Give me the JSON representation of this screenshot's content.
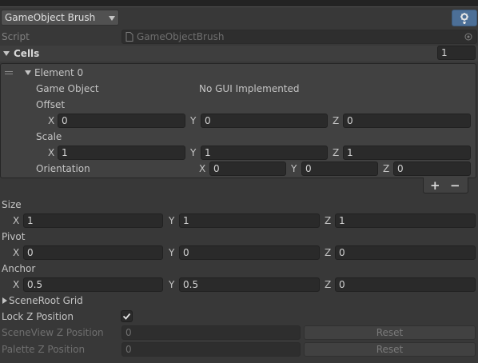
{
  "header": {
    "brush_dropdown": "GameObject Brush",
    "script_label": "Script",
    "script_value": "GameObjectBrush"
  },
  "cells": {
    "label": "Cells",
    "count": "1",
    "element": {
      "title": "Element 0",
      "game_object_label": "Game Object",
      "game_object_value": "No GUI Implemented",
      "offset_label": "Offset",
      "offset": {
        "x": "0",
        "y": "0",
        "z": "0"
      },
      "scale_label": "Scale",
      "scale": {
        "x": "1",
        "y": "1",
        "z": "1"
      },
      "orientation_label": "Orientation",
      "orientation": {
        "x": "0",
        "y": "0",
        "z": "0"
      }
    },
    "add_label": "+",
    "remove_label": "−"
  },
  "axes": {
    "x": "X",
    "y": "Y",
    "z": "Z"
  },
  "size": {
    "label": "Size",
    "x": "1",
    "y": "1",
    "z": "1"
  },
  "pivot": {
    "label": "Pivot",
    "x": "0",
    "y": "0",
    "z": "0"
  },
  "anchor": {
    "label": "Anchor",
    "x": "0.5",
    "y": "0.5",
    "z": "0"
  },
  "scene_root": {
    "label": "SceneRoot Grid"
  },
  "lock_z": {
    "label": "Lock Z Position",
    "checked": true
  },
  "scene_view_z": {
    "label": "SceneView Z Position",
    "value": "0",
    "reset_label": "Reset"
  },
  "palette_z": {
    "label": "Palette Z Position",
    "value": "0",
    "reset_label": "Reset"
  }
}
